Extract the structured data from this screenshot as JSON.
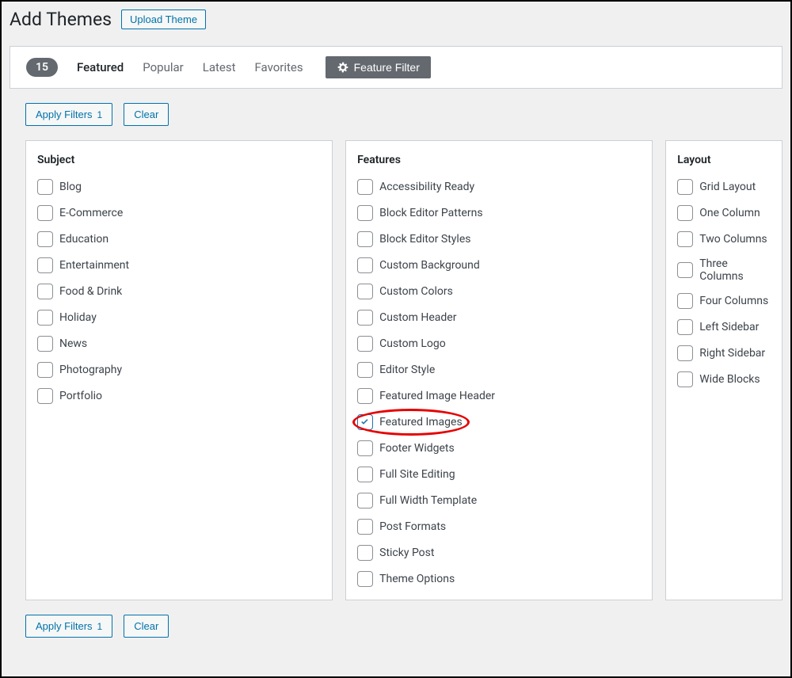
{
  "header": {
    "title": "Add Themes",
    "upload_label": "Upload Theme"
  },
  "filter_bar": {
    "count": "15",
    "links": [
      "Featured",
      "Popular",
      "Latest",
      "Favorites"
    ],
    "active_index": 0,
    "feature_filter_label": "Feature Filter"
  },
  "buttons": {
    "apply_label": "Apply Filters",
    "apply_count": "1",
    "clear_label": "Clear"
  },
  "groups": {
    "subject": {
      "title": "Subject",
      "items": [
        "Blog",
        "E-Commerce",
        "Education",
        "Entertainment",
        "Food & Drink",
        "Holiday",
        "News",
        "Photography",
        "Portfolio"
      ]
    },
    "features": {
      "title": "Features",
      "items": [
        "Accessibility Ready",
        "Block Editor Patterns",
        "Block Editor Styles",
        "Custom Background",
        "Custom Colors",
        "Custom Header",
        "Custom Logo",
        "Editor Style",
        "Featured Image Header",
        "Featured Images",
        "Footer Widgets",
        "Full Site Editing",
        "Full Width Template",
        "Post Formats",
        "Sticky Post",
        "Theme Options"
      ],
      "checked_index": 9,
      "highlight_index": 9
    },
    "layout": {
      "title": "Layout",
      "items": [
        "Grid Layout",
        "One Column",
        "Two Columns",
        "Three Columns",
        "Four Columns",
        "Left Sidebar",
        "Right Sidebar",
        "Wide Blocks"
      ]
    }
  }
}
